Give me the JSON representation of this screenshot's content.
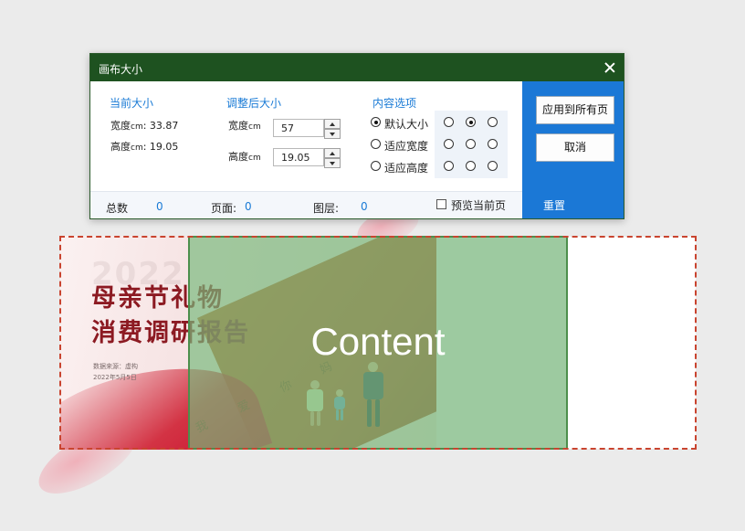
{
  "dialog": {
    "title": "画布大小",
    "current_size": {
      "heading": "当前大小",
      "width_label": "宽度",
      "width_unit": "cm",
      "width_value": "33.87",
      "height_label": "高度",
      "height_unit": "cm",
      "height_value": "19.05"
    },
    "adjusted_size": {
      "heading": "调整后大小",
      "width_label": "宽度",
      "width_unit": "cm",
      "width_value": "57",
      "height_label": "高度",
      "height_unit": "cm",
      "height_value": "19.05"
    },
    "content_options": {
      "heading": "内容选项",
      "options": [
        "默认大小",
        "适应宽度",
        "适应高度"
      ],
      "selected_option": "默认大小",
      "anchor_grid_selected": "top-center"
    },
    "status": {
      "total_label": "总数",
      "total_value": "0",
      "page_label": "页面:",
      "page_value": "0",
      "layer_label": "图层:",
      "layer_value": "0",
      "preview_label": "预览当前页",
      "preview_checked": false
    },
    "side": {
      "apply_all_label": "应用到所有页",
      "cancel_label": "取消",
      "reset_label": "重置"
    }
  },
  "preview": {
    "content_label": "Content",
    "slide": {
      "title_line1": "母亲节礼物",
      "title_line2": "消费调研报告",
      "year": "2022",
      "meta_source": "数据来源：虚构",
      "meta_date": "2022年5月5日",
      "book_words": [
        "我",
        "爱",
        "你",
        "妈"
      ]
    }
  },
  "colors": {
    "titlebar": "#1e5220",
    "accent_blue": "#1b78d6",
    "green_overlay": "#78ba7c",
    "dashed_border": "#c9442f",
    "slide_title": "#8c1a22"
  }
}
